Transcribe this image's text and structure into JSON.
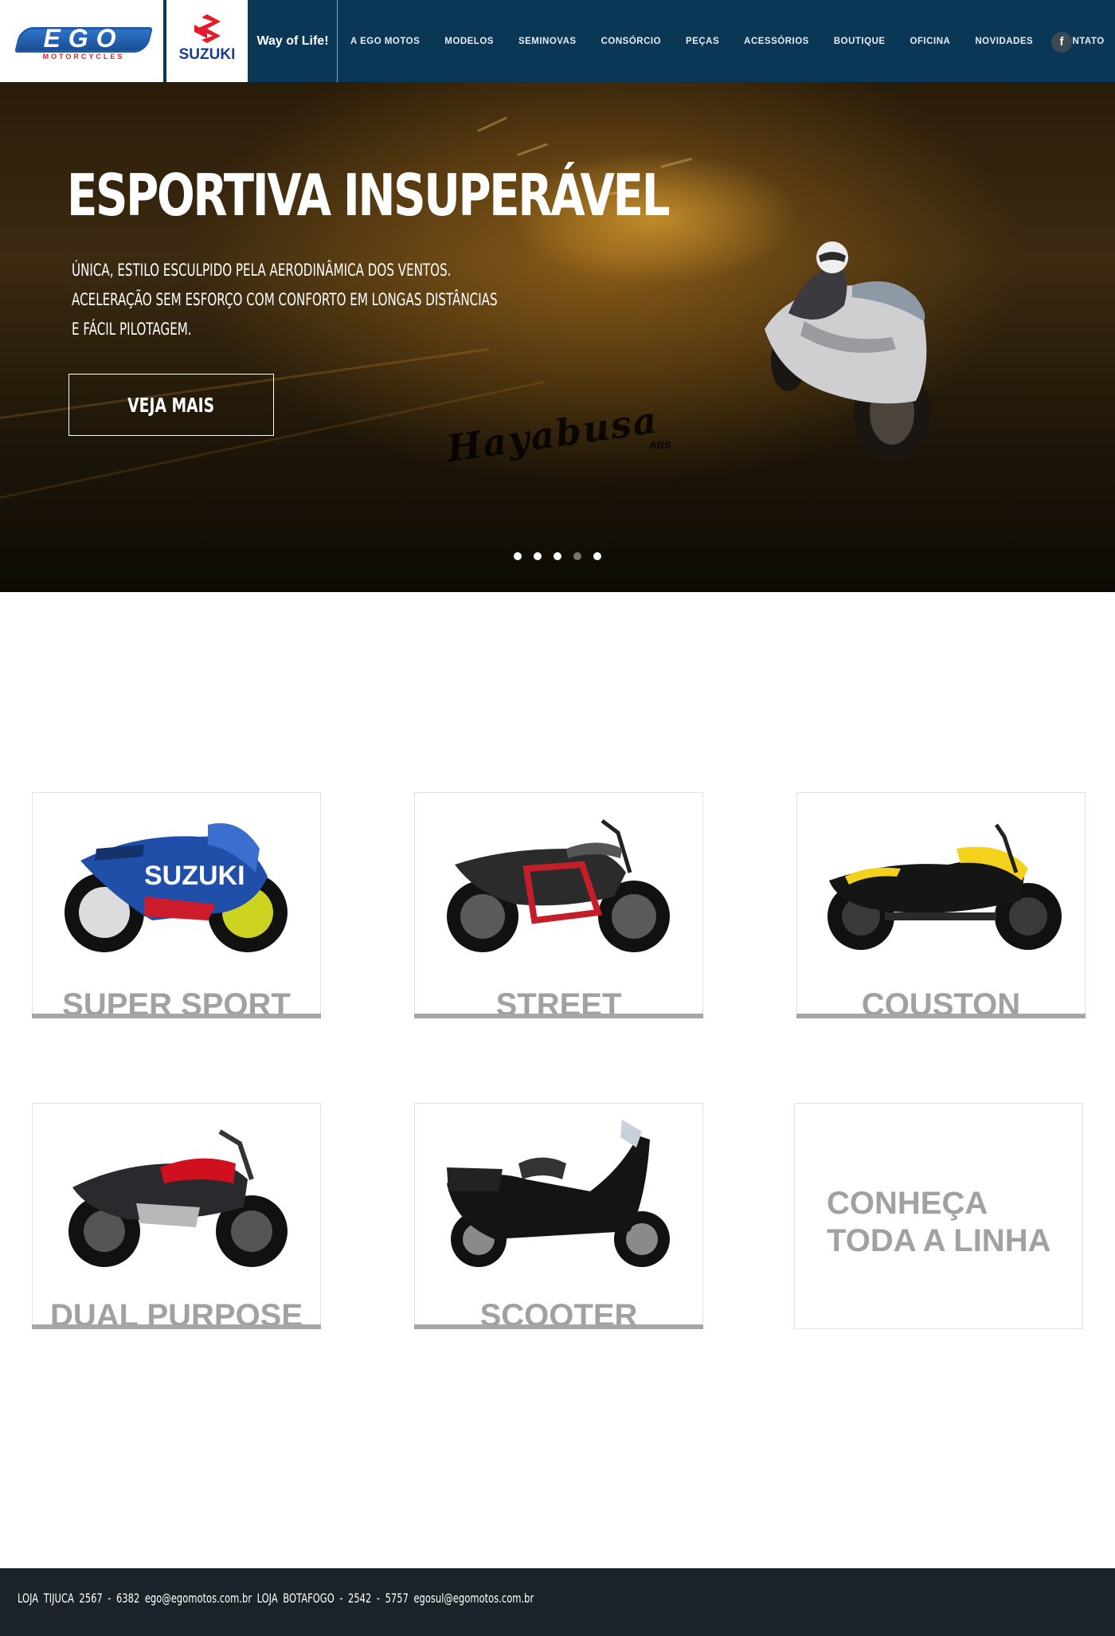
{
  "header": {
    "brand_ego": "EGO",
    "brand_ego_sub": "MOTORCYCLES",
    "brand_suzuki": "SUZUKI",
    "tagline": "Way of Life!",
    "nav": [
      "A EGO MOTOS",
      "MODELOS",
      "SEMINOVAS",
      "CONSÓRCIO",
      "PEÇAS",
      "ACESSÓRIOS",
      "BOUTIQUE",
      "OFICINA",
      "NOVIDADES",
      "CONTATO"
    ],
    "facebook_icon": "f",
    "colors": {
      "bar": "#0b3756",
      "ego_blue": "#1e5aa6",
      "suzuki_red": "#e21c2a"
    }
  },
  "hero": {
    "title": "ESPORTIVA INSUPERÁVEL",
    "lines": [
      "ÚNICA, ESTILO ESCULPIDO PELA AERODINÂMICA DOS VENTOS.",
      "ACELERAÇÃO SEM ESFORÇO COM CONFORTO EM LONGAS DISTÂNCIAS",
      "E FÁCIL PILOTAGEM."
    ],
    "button": "VEJA MAIS",
    "model_logo": "Hayabusa",
    "model_logo_sub": "ABS",
    "slides": 5,
    "active_slide": 4
  },
  "categories": [
    {
      "label": "SUPER SPORT",
      "accent": "#1f4fa8"
    },
    {
      "label": "STREET",
      "accent": "#c41e2a"
    },
    {
      "label": "COUSTON",
      "accent": "#f2d21b"
    },
    {
      "label": "DUAL PURPOSE",
      "accent": "#d0101e"
    },
    {
      "label": "SCOOTER",
      "accent": "#222222"
    }
  ],
  "all_line": {
    "line1": "CONHEÇA",
    "line2": "TODA A LINHA"
  },
  "footer": {
    "text": "LOJA TIJUCA   2567 - 6382   ego@egomotos.com.br   LOJA BOTAFOGO - 2542 - 5757   egosul@egomotos.com.br"
  }
}
